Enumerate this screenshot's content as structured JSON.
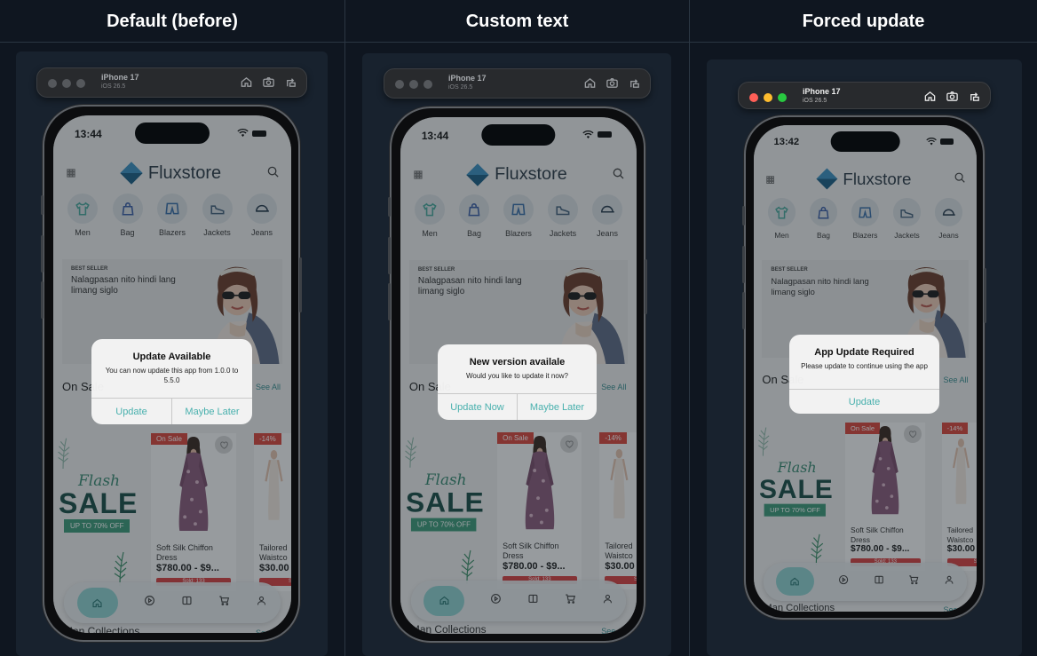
{
  "columns": [
    {
      "heading": "Default (before)",
      "device": {
        "name": "iPhone 17",
        "os": "iOS 26.5"
      },
      "time": "13:44",
      "alert": {
        "title": "Update Available",
        "message": "You can now update this app from 1.0.0 to 5.5.0",
        "buttons": [
          "Update",
          "Maybe Later"
        ]
      }
    },
    {
      "heading": "Custom text",
      "device": {
        "name": "iPhone 17",
        "os": "iOS 26.5"
      },
      "time": "13:44",
      "alert": {
        "title": "New version availale",
        "message": "Would you like to update it now?",
        "buttons": [
          "Update Now",
          "Maybe Later"
        ]
      }
    },
    {
      "heading": "Forced update",
      "device": {
        "name": "iPhone 17",
        "os": "iOS 26.5"
      },
      "time": "13:42",
      "alert": {
        "title": "App Update Required",
        "message": "Please update to continue using the app",
        "buttons": [
          "Update"
        ]
      }
    }
  ],
  "app": {
    "brand": "Fluxstore",
    "categories": [
      "Men",
      "Bag",
      "Blazers",
      "Jackets",
      "Jeans"
    ],
    "banner": {
      "tag": "BEST SELLER",
      "copy": "Nalagpasan nito hindi lang limang siglo"
    },
    "section": {
      "title": "On Sale",
      "see_all": "See All"
    },
    "flash": {
      "line1": "Flash",
      "line2": "SALE",
      "badge": "UP TO 70% OFF"
    },
    "products": [
      {
        "badge": "On Sale",
        "name": "Soft Silk Chiffon Dress",
        "price": "$780.00 - $9...",
        "sold": "Sold: 133"
      },
      {
        "badge": "-14%",
        "name": "Tailored Waistco",
        "price": "$30.00",
        "sold": "Sold"
      }
    ],
    "bottom_section": {
      "title": "Man Collections",
      "see_all": "See"
    }
  },
  "colors": {
    "accent": "#48b0ad",
    "sale_red": "#d8473d",
    "background": "#0f1620"
  }
}
